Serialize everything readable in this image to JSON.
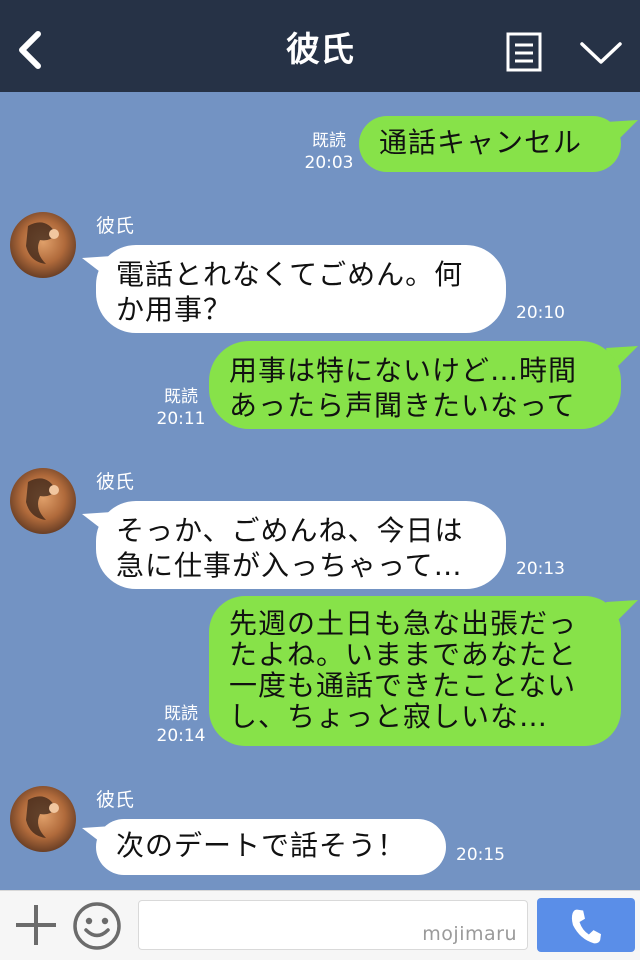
{
  "header": {
    "title": "彼氏"
  },
  "colors": {
    "header_bg": "#263246",
    "chat_bg": "#7393c3",
    "outgoing_bubble": "#87e249",
    "incoming_bubble": "#ffffff",
    "call_button": "#5a8ee8"
  },
  "icons": {
    "back": "chevron-left-icon",
    "memo": "note-icon",
    "menu": "chevron-down-icon",
    "add": "plus-icon",
    "sticker": "smiley-icon",
    "call": "phone-icon"
  },
  "messages": [
    {
      "direction": "out",
      "text": "通話キャンセル",
      "read": "既読",
      "time": "20:03"
    },
    {
      "direction": "in",
      "sender": "彼氏",
      "text": "電話とれなくてごめん。何か用事？",
      "time": "20:10"
    },
    {
      "direction": "out",
      "text": "用事は特にないけど…時間あったら声聞きたいなって",
      "read": "既読",
      "time": "20:11"
    },
    {
      "direction": "in",
      "sender": "彼氏",
      "text": "そっか、ごめんね、今日は急に仕事が入っちゃって…",
      "time": "20:13"
    },
    {
      "direction": "out",
      "text": "先週の土日も急な出張だったよね。いままであなたと一度も通話できたことないし、ちょっと寂しいな…",
      "read": "既読",
      "time": "20:14"
    },
    {
      "direction": "in",
      "sender": "彼氏",
      "text": "次のデートで話そう！",
      "time": "20:15"
    }
  ],
  "input": {
    "value": "",
    "watermark": "mojimaru"
  }
}
